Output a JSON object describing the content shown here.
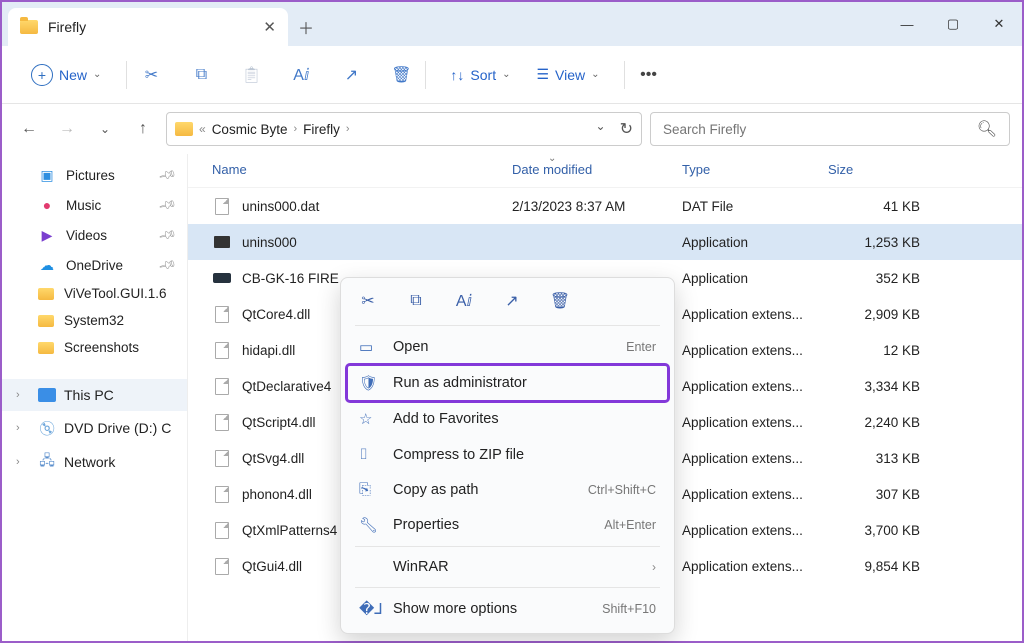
{
  "window": {
    "title": "Firefly"
  },
  "toolbar": {
    "new": "New",
    "sort": "Sort",
    "view": "View"
  },
  "breadcrumb": {
    "p1": "Cosmic Byte",
    "p2": "Firefly"
  },
  "search": {
    "placeholder": "Search Firefly"
  },
  "sidebar": {
    "quick": [
      {
        "label": "Pictures"
      },
      {
        "label": "Music"
      },
      {
        "label": "Videos"
      },
      {
        "label": "OneDrive"
      },
      {
        "label": "ViVeTool.GUI.1.6"
      },
      {
        "label": "System32"
      },
      {
        "label": "Screenshots"
      }
    ],
    "groups": {
      "thispc": "This PC",
      "dvd": "DVD Drive (D:) C",
      "network": "Network"
    }
  },
  "columns": {
    "name": "Name",
    "date": "Date modified",
    "type": "Type",
    "size": "Size"
  },
  "rows": [
    {
      "name": "unins000.dat",
      "date": "2/13/2023 8:37 AM",
      "type": "DAT File",
      "size": "41 KB",
      "icon": "file"
    },
    {
      "name": "unins000",
      "date": "",
      "type": "Application",
      "size": "1,253 KB",
      "icon": "app",
      "selected": true
    },
    {
      "name": "CB-GK-16 FIRE",
      "date": "",
      "type": "Application",
      "size": "352 KB",
      "icon": "kb"
    },
    {
      "name": "QtCore4.dll",
      "date": "",
      "type": "Application extens...",
      "size": "2,909 KB",
      "icon": "file"
    },
    {
      "name": "hidapi.dll",
      "date": "",
      "type": "Application extens...",
      "size": "12 KB",
      "icon": "file"
    },
    {
      "name": "QtDeclarative4",
      "date": "",
      "type": "Application extens...",
      "size": "3,334 KB",
      "icon": "file"
    },
    {
      "name": "QtScript4.dll",
      "date": "",
      "type": "Application extens...",
      "size": "2,240 KB",
      "icon": "file"
    },
    {
      "name": "QtSvg4.dll",
      "date": "",
      "type": "Application extens...",
      "size": "313 KB",
      "icon": "file"
    },
    {
      "name": "phonon4.dll",
      "date": "",
      "type": "Application extens...",
      "size": "307 KB",
      "icon": "file"
    },
    {
      "name": "QtXmlPatterns4",
      "date": "",
      "type": "Application extens...",
      "size": "3,700 KB",
      "icon": "file"
    },
    {
      "name": "QtGui4.dll",
      "date": "",
      "type": "Application extens...",
      "size": "9,854 KB",
      "icon": "file"
    }
  ],
  "ctx": {
    "open": "Open",
    "open_hint": "Enter",
    "runas": "Run as administrator",
    "fav": "Add to Favorites",
    "zip": "Compress to ZIP file",
    "copypath": "Copy as path",
    "copypath_hint": "Ctrl+Shift+C",
    "props": "Properties",
    "props_hint": "Alt+Enter",
    "winrar": "WinRAR",
    "more": "Show more options",
    "more_hint": "Shift+F10"
  }
}
